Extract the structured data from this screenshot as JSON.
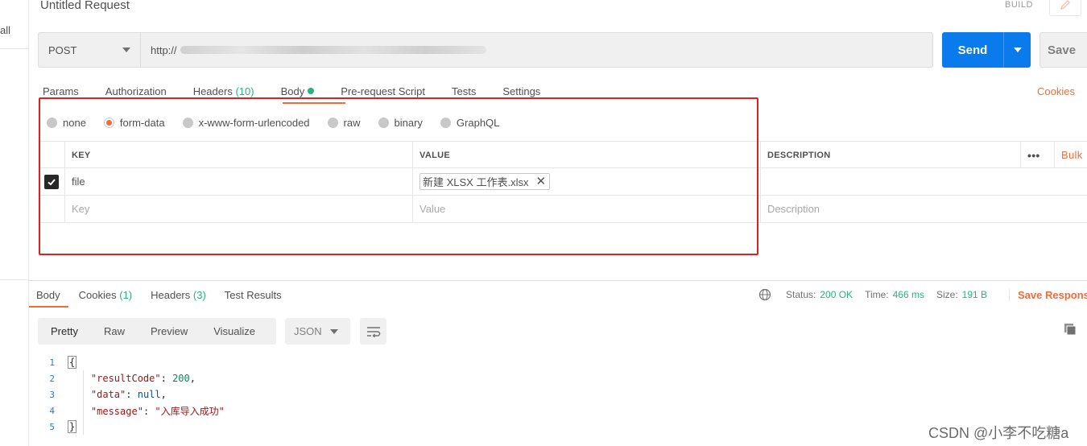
{
  "sidebar": {
    "partial_label": "all"
  },
  "header": {
    "title": "Untitled Request",
    "mode_label": "BUILD"
  },
  "request": {
    "method": "POST",
    "url_visible_prefix": "http://"
  },
  "actions": {
    "send_label": "Send",
    "save_label": "Save"
  },
  "request_tabs": [
    {
      "label": "Params",
      "count": ""
    },
    {
      "label": "Authorization",
      "count": ""
    },
    {
      "label": "Headers",
      "count": "(10)"
    },
    {
      "label": "Body",
      "count": ""
    },
    {
      "label": "Pre-request Script",
      "count": ""
    },
    {
      "label": "Tests",
      "count": ""
    },
    {
      "label": "Settings",
      "count": ""
    }
  ],
  "active_request_tab": "Body",
  "cookies_label": "Cookies",
  "body_types": [
    "none",
    "form-data",
    "x-www-form-urlencoded",
    "raw",
    "binary",
    "GraphQL"
  ],
  "selected_body_type": "form-data",
  "kv_table": {
    "headers": {
      "key": "KEY",
      "value": "VALUE",
      "description": "DESCRIPTION",
      "more": "•••",
      "bulk": "Bulk"
    },
    "rows": [
      {
        "checked": true,
        "key": "file",
        "value_file": "新建 XLSX 工作表.xlsx",
        "description": ""
      }
    ],
    "placeholders": {
      "key": "Key",
      "value": "Value",
      "description": "Description"
    }
  },
  "response": {
    "tabs": [
      {
        "label": "Body",
        "count": ""
      },
      {
        "label": "Cookies",
        "count": "(1)"
      },
      {
        "label": "Headers",
        "count": "(3)"
      },
      {
        "label": "Test Results",
        "count": ""
      }
    ],
    "active_tab": "Body",
    "status_label": "Status:",
    "status_value": "200 OK",
    "time_label": "Time:",
    "time_value": "466 ms",
    "size_label": "Size:",
    "size_value": "191 B",
    "save_label": "Save Respons",
    "formats": [
      "Pretty",
      "Raw",
      "Preview",
      "Visualize"
    ],
    "active_format": "Pretty",
    "language": "JSON",
    "code_lines": [
      {
        "n": "1",
        "open": "{"
      },
      {
        "n": "2",
        "key": "\"resultCode\"",
        "value": "200",
        "type": "number",
        "comma": ","
      },
      {
        "n": "3",
        "key": "\"data\"",
        "value": "null",
        "type": "keyword",
        "comma": ","
      },
      {
        "n": "4",
        "key": "\"message\"",
        "value": "\"入库导入成功\"",
        "type": "string",
        "comma": ""
      },
      {
        "n": "5",
        "close": "}"
      }
    ]
  },
  "watermark": "CSDN @小李不吃糖a",
  "colors": {
    "accent_orange": "#f26b3a",
    "send_blue": "#097bed",
    "success_green": "#26b47f",
    "highlight_red": "#e0201b"
  }
}
